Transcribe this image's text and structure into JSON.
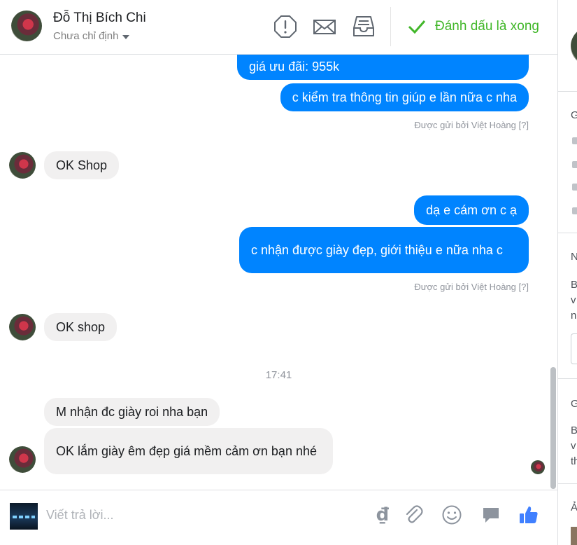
{
  "header": {
    "contact_name": "Đỗ Thị Bích Chi",
    "assignee": "Chưa chỉ định",
    "done_label": "Đánh dấu là xong",
    "icons": [
      "alert-icon",
      "mail-icon",
      "inbox-icon",
      "checkmark-icon"
    ],
    "done_color": "#42b72a"
  },
  "thread": {
    "messages": [
      {
        "dir": "out",
        "text": "giá ưu đãi: 955k"
      },
      {
        "dir": "out",
        "text": "c kiểm tra thông tin giúp e lần nữa c nha"
      },
      {
        "dir": "meta",
        "text": "Được gửi bởi Việt Hoàng",
        "help": "[?]"
      },
      {
        "dir": "in",
        "text": "OK Shop"
      },
      {
        "dir": "out",
        "text": "dạ e cám ơn c ạ"
      },
      {
        "dir": "out",
        "text": "c nhận được giày đẹp, giới thiệu e nữa nha c"
      },
      {
        "dir": "meta",
        "text": "Được gửi bởi Việt Hoàng",
        "help": "[?]"
      },
      {
        "dir": "in",
        "text": "OK shop"
      },
      {
        "dir": "time",
        "text": "17:41"
      },
      {
        "dir": "in",
        "text": "M nhận đc giày roi nha bạn"
      },
      {
        "dir": "in",
        "text": "OK lắm giày êm đẹp giá mềm cảm ơn bạn nhé"
      }
    ],
    "outgoing_color": "#0084ff",
    "incoming_color": "#f1f0f0"
  },
  "composer": {
    "placeholder": "Viết trả lời...",
    "currency_symbol": "₫",
    "icons": [
      "currency-icon",
      "attachment-icon",
      "emoji-icon",
      "saved-reply-icon",
      "like-icon"
    ],
    "like_color": "#4080ff"
  },
  "side_panel": {
    "letters": [
      "G",
      "N",
      "B",
      "v",
      "n",
      "G",
      "B",
      "v",
      "th",
      "Ả"
    ]
  }
}
